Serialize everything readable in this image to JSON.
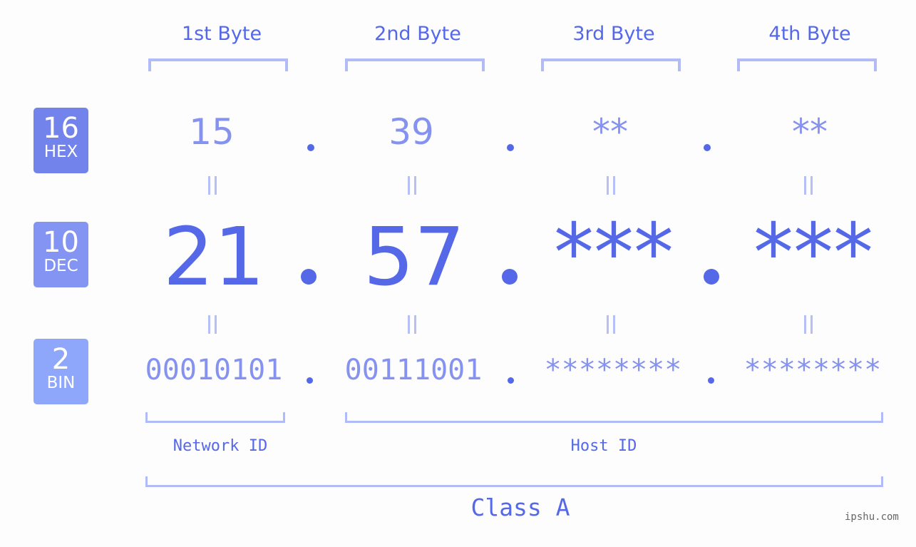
{
  "headers": [
    "1st Byte",
    "2nd Byte",
    "3rd Byte",
    "4th Byte"
  ],
  "rows": {
    "hex": {
      "base": "16",
      "name": "HEX",
      "color": "#7283ec",
      "values": [
        "15",
        "39",
        "**",
        "**"
      ]
    },
    "dec": {
      "base": "10",
      "name": "DEC",
      "color": "#8494f2",
      "values": [
        "21",
        "57",
        "***",
        "***"
      ]
    },
    "bin": {
      "base": "2",
      "name": "BIN",
      "color": "#8fa7fa",
      "values": [
        "00010101",
        "00111001",
        "********",
        "********"
      ]
    }
  },
  "segments": {
    "network": "Network ID",
    "host": "Host ID",
    "class": "Class A"
  },
  "watermark": "ipshu.com",
  "colors": {
    "accent": "#5468e8",
    "light_accent": "#8592ef",
    "bracket": "#b1bbf8"
  }
}
